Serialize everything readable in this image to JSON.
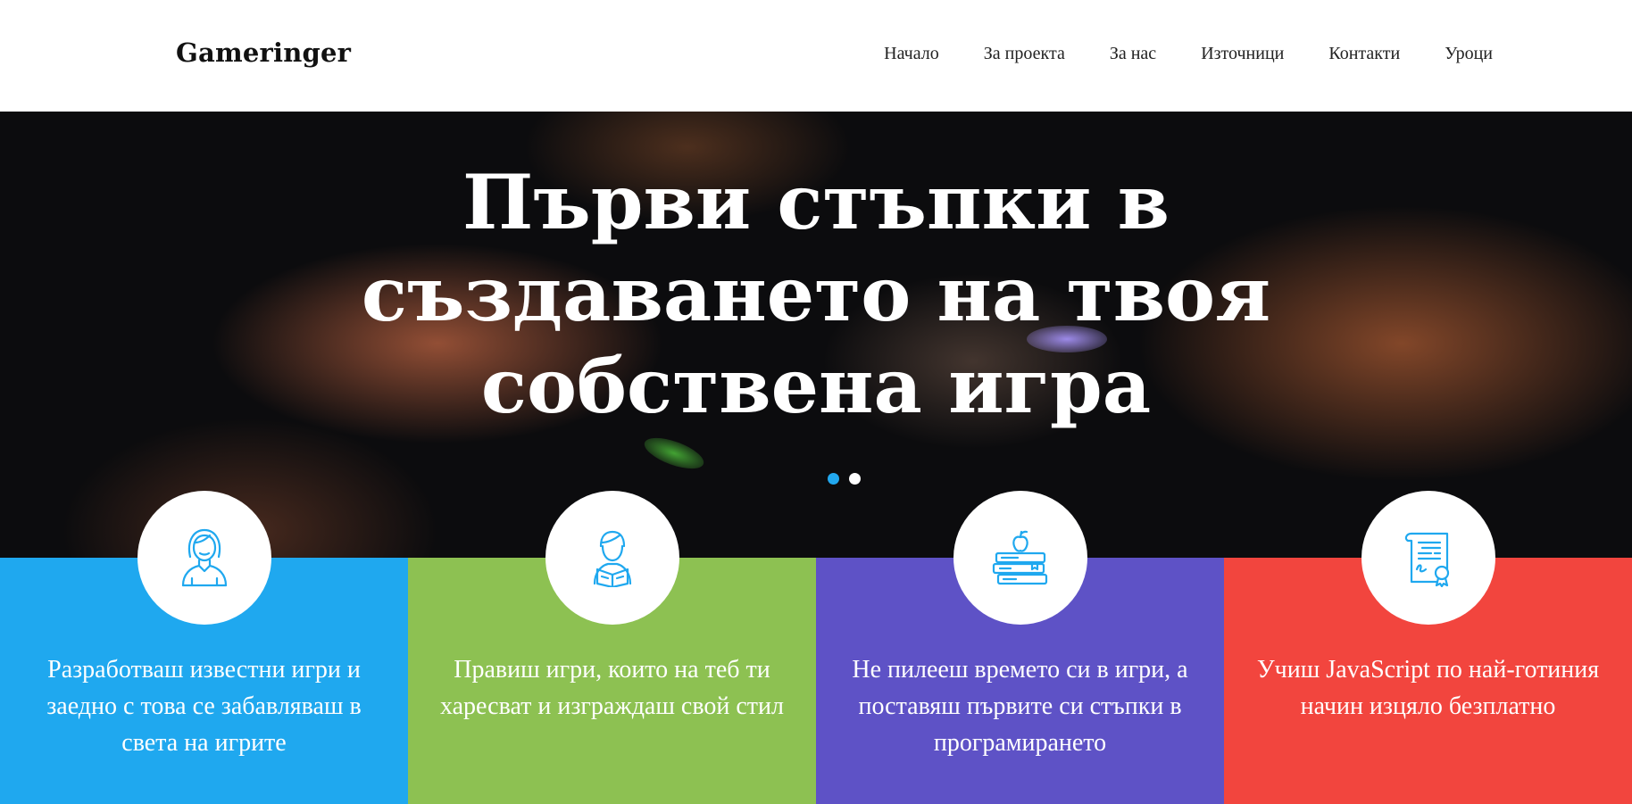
{
  "header": {
    "logo": "Gameringer",
    "nav": [
      "Начало",
      "За проекта",
      "За нас",
      "Източници",
      "Контакти",
      "Уроци"
    ]
  },
  "hero": {
    "title_lines": [
      "Първи стъпки в",
      "създаването на твоя",
      "собствена игра"
    ],
    "slides": 2,
    "active_slide": 1
  },
  "features": [
    {
      "icon": "woman-icon",
      "color": "#1fa8ef",
      "text": "Разработваш известни игри и заедно с това се забавляваш в света на игрите"
    },
    {
      "icon": "reader-icon",
      "color": "#8dc152",
      "text": "Правиш игри, които на теб ти харесват и изграждаш свой стил"
    },
    {
      "icon": "books-apple-icon",
      "color": "#5e52c6",
      "text": "Не пилееш времето си в игри, а поставяш първите си стъпки в програмирането"
    },
    {
      "icon": "certificate-icon",
      "color": "#f2453e",
      "text": "Учиш JavaScript по най-готиния начин изцяло безплатно"
    }
  ],
  "colors": {
    "accent": "#1fa8ef",
    "icon": "#1fa8ef"
  }
}
